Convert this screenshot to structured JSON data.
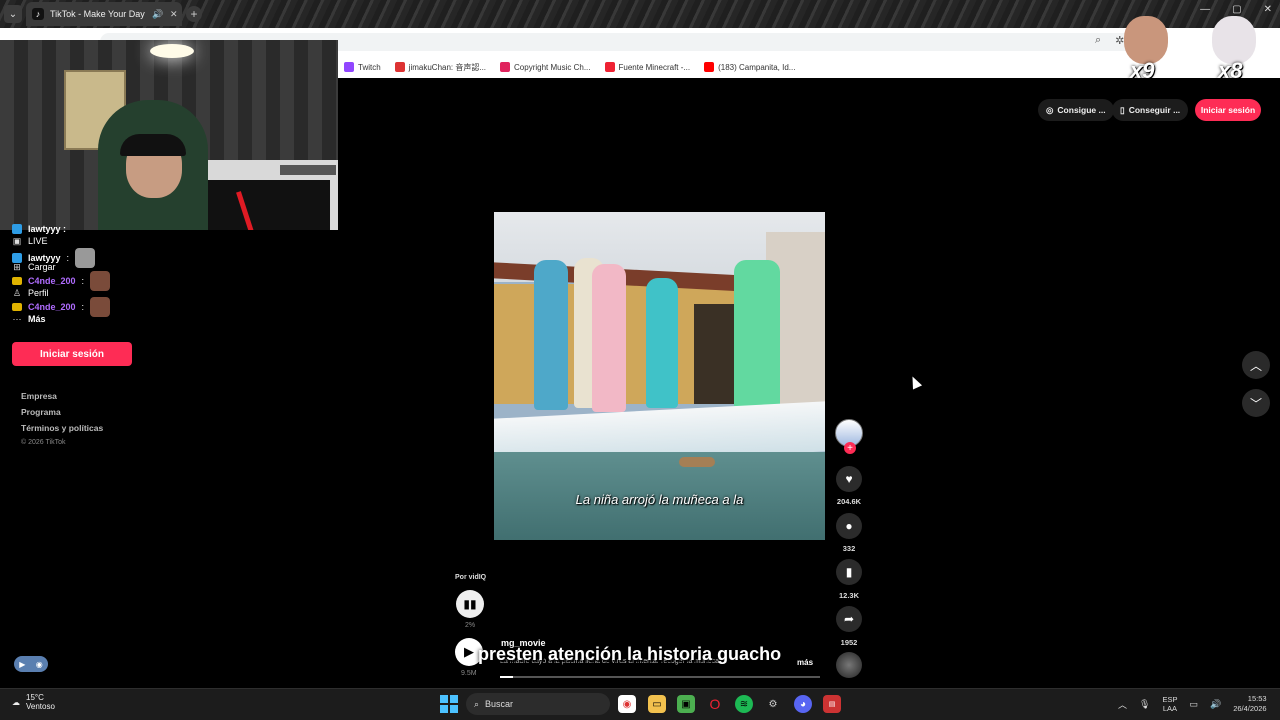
{
  "browser": {
    "tab_title": "TikTok - Make Your Day",
    "tab_icon": "tiktok-icon",
    "bookmarks": [
      {
        "label": "Twitch",
        "icon": "twitch-icon",
        "color": "#9146ff"
      },
      {
        "label": "jimakuChan: 音声認...",
        "icon": "jimaku-icon",
        "color": "#d33"
      },
      {
        "label": "Copyright Music Ch...",
        "icon": "play-icon",
        "color": "#e0245e"
      },
      {
        "label": "Fuente Minecraft -...",
        "icon": "fuente-icon",
        "color": "#e23"
      },
      {
        "label": "(183) Campanita, Id...",
        "icon": "youtube-icon",
        "color": "#f00"
      }
    ]
  },
  "stream_overlay": {
    "multiplier_1": "x9",
    "multiplier_2": "x8",
    "subtitle": "presten atención la historia guacho"
  },
  "sidebar": {
    "chat": [
      {
        "user": "lawtyyy",
        "sep": " :"
      },
      {
        "user": "C4nde_200",
        "sep": " :"
      },
      {
        "user": "C4nde_200",
        "sep": " :"
      }
    ],
    "live_label": "LIVE",
    "upload_label": "Cargar",
    "profile_label": "Perfil",
    "more_label": "Más",
    "login_button": "Iniciar sesión",
    "footer": [
      "Empresa",
      "Programa",
      "Términos y políticas"
    ],
    "copyright": "© 2026 TikTok"
  },
  "header_actions": {
    "get_coins": "Consigue ...",
    "get_app": "Conseguir ...",
    "login": "Iniciar sesión"
  },
  "video": {
    "caption": "La niña arrojó la muñeca a la",
    "by_line": "Por vidIQ",
    "stats_pct": "2%",
    "views": "9.5M",
    "author": "mg_movie",
    "description": "La madre cayó a la piscina llena de virus al intentar recoger la muñeca de",
    "more": "más",
    "progress": 0.04
  },
  "actions": {
    "likes": "204.6K",
    "comments": "332",
    "saves": "12.3K",
    "shares": "1952"
  },
  "taskbar": {
    "temp": "15°C",
    "weather": "Ventoso",
    "search_placeholder": "Buscar",
    "lang_1": "ESP",
    "lang_2": "LAA",
    "time": "15:53",
    "date": "26/4/2026"
  }
}
